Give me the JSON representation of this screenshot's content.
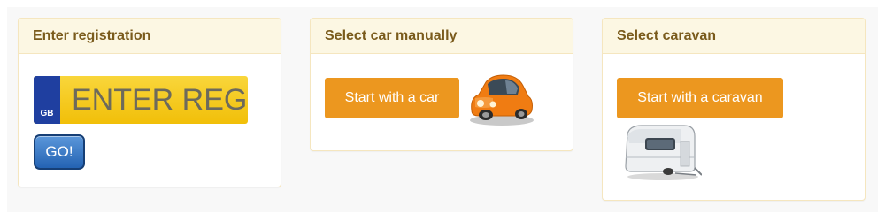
{
  "panels": {
    "registration": {
      "heading": "Enter registration",
      "plate_country": "GB",
      "plate_placeholder": "ENTER REG",
      "plate_value": "",
      "go_label": "GO!"
    },
    "car": {
      "heading": "Select car manually",
      "button_label": "Start with a car",
      "image_icon": "car-icon"
    },
    "caravan": {
      "heading": "Select caravan",
      "button_label": "Start with a caravan",
      "image_icon": "caravan-icon"
    }
  },
  "colors": {
    "heading_bg": "#fcf7e3",
    "heading_text": "#7a5b1c",
    "button_orange": "#ec971f",
    "plate_yellow": "#f5c712",
    "plate_blue": "#1f3fa0",
    "go_blue": "#2463b3"
  }
}
